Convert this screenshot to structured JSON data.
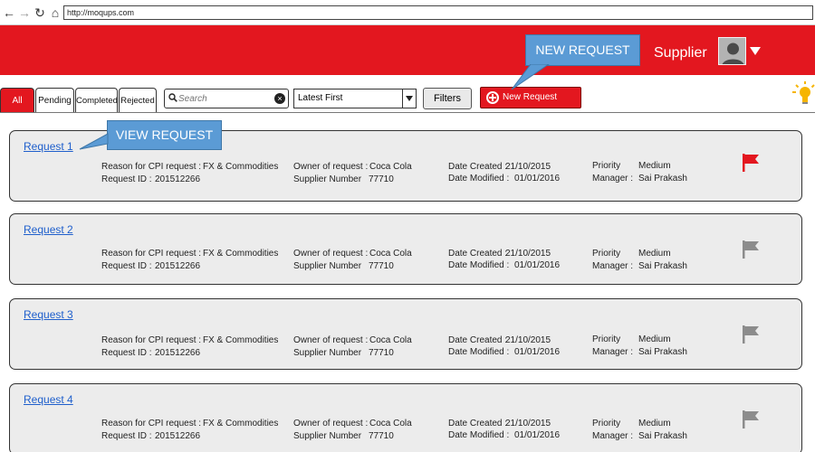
{
  "browser": {
    "url": "http://moqups.com"
  },
  "header": {
    "user_label": "Supplier"
  },
  "tabs": [
    "All",
    "Pending",
    "Completed",
    "Rejected"
  ],
  "search": {
    "placeholder": "Search"
  },
  "sort": {
    "selected": "Latest First"
  },
  "filters_label": "Filters",
  "new_request_label": "New Request",
  "callouts": {
    "new_request": "NEW REQUEST",
    "view_request": "VIEW REQUEST"
  },
  "labels": {
    "reason": "Reason for CPI request  :",
    "request_id": "Request ID  :",
    "owner": "Owner of request  :",
    "supplier_number": "Supplier Number",
    "date_created": "Date Created  :",
    "date_modified": "Date Modified  :",
    "priority": "Priority",
    "manager": "Manager  :"
  },
  "requests": [
    {
      "title": "Request 1",
      "reason": "FX & Commodities",
      "request_id": "201512266",
      "owner": "Coca Cola",
      "supplier_number": "77710",
      "date_created": "21/10/2015",
      "date_modified": "01/01/2016",
      "priority": "Medium",
      "manager": "Sai Prakash",
      "flag_color": "#e3171f"
    },
    {
      "title": "Request 2",
      "reason": "FX & Commodities",
      "request_id": "201512266",
      "owner": "Coca Cola",
      "supplier_number": "77710",
      "date_created": "21/10/2015",
      "date_modified": "01/01/2016",
      "priority": "Medium",
      "manager": "Sai Prakash",
      "flag_color": "#8c8c8c"
    },
    {
      "title": "Request 3",
      "reason": "FX & Commodities",
      "request_id": "201512266",
      "owner": "Coca Cola",
      "supplier_number": "77710",
      "date_created": "21/10/2015",
      "date_modified": "01/01/2016",
      "priority": "Medium",
      "manager": "Sai Prakash",
      "flag_color": "#8c8c8c"
    },
    {
      "title": "Request 4",
      "reason": "FX & Commodities",
      "request_id": "201512266",
      "owner": "Coca Cola",
      "supplier_number": "77710",
      "date_created": "21/10/2015",
      "date_modified": "01/01/2016",
      "priority": "Medium",
      "manager": "Sai Prakash",
      "flag_color": "#8c8c8c"
    }
  ],
  "colors": {
    "brand_red": "#e3171f",
    "callout_blue": "#5b9bd5",
    "link_blue": "#1f5fcc"
  }
}
